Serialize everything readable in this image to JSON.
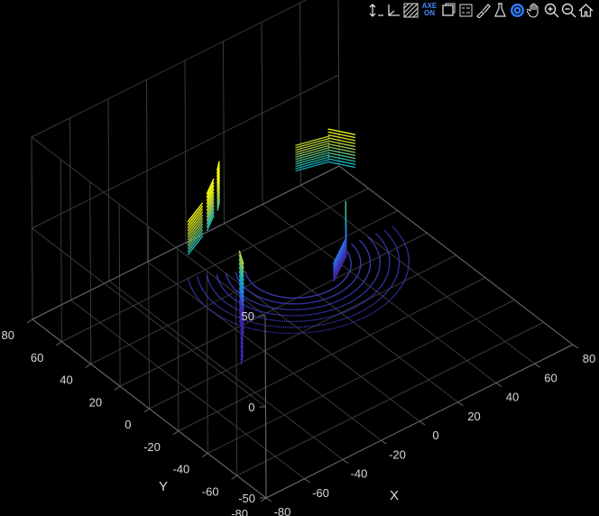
{
  "toolbar": {
    "buttons": [
      {
        "name": "data-tips-icon"
      },
      {
        "name": "axes-orientation-icon"
      },
      {
        "name": "grid-toggle-icon"
      },
      {
        "name": "axe-on-toggle",
        "label_top": "AXE",
        "label_bottom": "ON"
      },
      {
        "name": "rotate-view-icon"
      },
      {
        "name": "legend-icon"
      },
      {
        "name": "brush-icon"
      },
      {
        "name": "colorbar-icon"
      },
      {
        "name": "restore-view-target-icon"
      },
      {
        "name": "pan-hand-icon"
      },
      {
        "name": "zoom-in-icon"
      },
      {
        "name": "zoom-out-icon"
      },
      {
        "name": "home-icon"
      }
    ],
    "accent_color": "#2f7bff"
  },
  "chart_data": {
    "type": "scatter3d",
    "colormap": "parula",
    "background": "#000000",
    "grid": true,
    "xlabel": "X",
    "ylabel": "Y",
    "xlim": [
      -80,
      80
    ],
    "ylim": [
      -80,
      80
    ],
    "zlim": [
      -50,
      50
    ],
    "x_ticks": [
      "-80",
      "-60",
      "-40",
      "-20",
      "0",
      "20",
      "40",
      "60",
      "80"
    ],
    "y_ticks": [
      "80",
      "60",
      "40",
      "20",
      "0",
      "-20",
      "-40",
      "-60",
      "-80"
    ],
    "z_ticks": [
      "50",
      "0",
      "-50"
    ]
  }
}
